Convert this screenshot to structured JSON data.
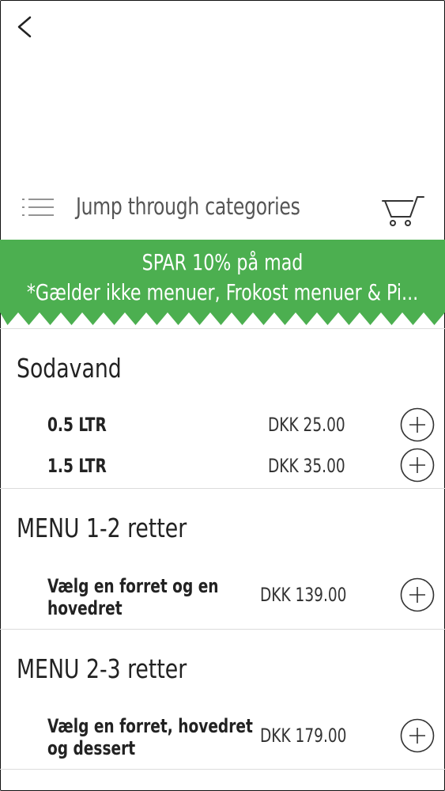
{
  "categories": {
    "label": "Jump through categories"
  },
  "icons": {
    "back": "chevron-left-icon",
    "menu": "list-menu-icon",
    "cart": "shopping-cart-icon",
    "add": "plus-circle-icon"
  },
  "promo": {
    "line1": "SPAR 10% på mad",
    "line2": "*Gælder ikke menuer, Frokost menuer & Pi...",
    "color": "#4caf50"
  },
  "sections": [
    {
      "title": "Sodavand",
      "items": [
        {
          "name": "0.5 LTR",
          "price": "DKK 25.00"
        },
        {
          "name": "1.5 LTR",
          "price": "DKK 35.00"
        }
      ]
    },
    {
      "title": "MENU 1-2 retter",
      "items": [
        {
          "name_line1": "Vælg en forret og en",
          "name_line2": "hovedret",
          "price": "DKK 139.00"
        }
      ]
    },
    {
      "title": "MENU 2-3 retter",
      "items": [
        {
          "name_line1": "Vælg en forret, hovedret",
          "name_line2": "og dessert",
          "price": "DKK 179.00"
        }
      ]
    }
  ]
}
